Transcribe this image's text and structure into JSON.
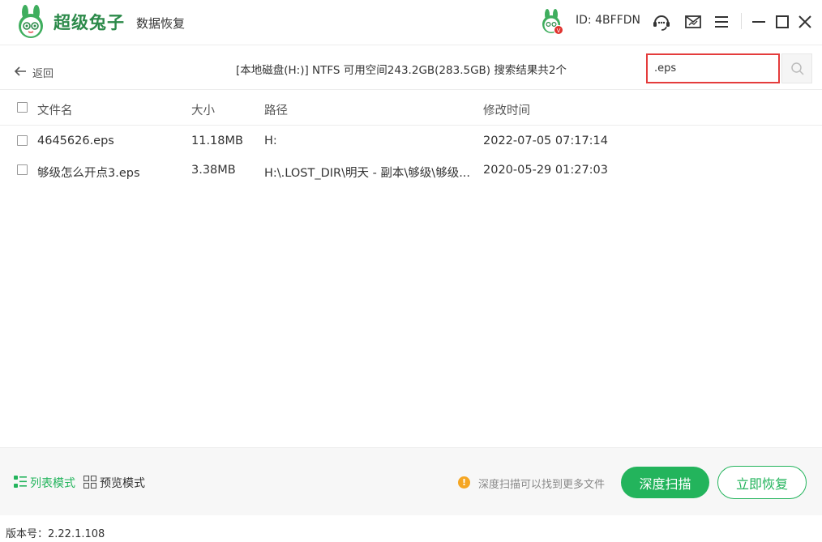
{
  "app": {
    "brand_name": "超级兔子",
    "brand_sub": "数据恢复",
    "user_id": "ID: 4BFFDN",
    "vip_badge": "V",
    "accent_color": "#23b45c",
    "icons": [
      "support-icon",
      "feedback-icon",
      "menu-icon",
      "minimize-icon",
      "maximize-icon",
      "close-icon"
    ]
  },
  "subheader": {
    "back_label": "返回",
    "disk_info": "[本地磁盘(H:)] NTFS 可用空间243.2GB(283.5GB) 搜索结果共2个",
    "search_value": ".eps"
  },
  "table": {
    "columns": [
      "文件名",
      "大小",
      "路径",
      "修改时间"
    ],
    "rows": [
      {
        "name": "4645626.eps",
        "size": "11.18MB",
        "path": "H:",
        "modified": "2022-07-05 07:17:14"
      },
      {
        "name": "够级怎么开点3.eps",
        "size": "3.38MB",
        "path": "H:\\.LOST_DIR\\明天 - 副本\\够级\\够级...",
        "modified": "2020-05-29 01:27:03"
      }
    ]
  },
  "footer": {
    "list_mode": "列表模式",
    "preview_mode": "预览模式",
    "hint": "深度扫描可以找到更多文件",
    "deep_scan": "深度扫描",
    "recover": "立即恢复"
  },
  "version": "版本号：2.22.1.108"
}
